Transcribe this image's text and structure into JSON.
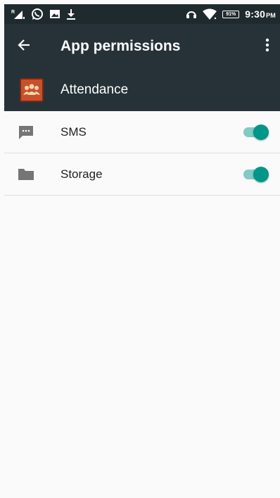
{
  "status_bar": {
    "left_icons": [
      "signal-roaming-icon",
      "whatsapp-icon",
      "image-icon",
      "download-icon"
    ],
    "right_icons": [
      "headset-icon",
      "wifi-icon",
      "battery-icon"
    ],
    "battery_percent": "91%",
    "time": "9:30",
    "ampm": "PM"
  },
  "toolbar": {
    "title": "App permissions",
    "back_icon": "arrow-back-icon",
    "overflow_icon": "more-vert-icon"
  },
  "app": {
    "name": "Attendance",
    "icon": "attendance-app-icon",
    "icon_color": "#c8502c"
  },
  "permissions": [
    {
      "label": "SMS",
      "icon": "message-icon",
      "enabled": true
    },
    {
      "label": "Storage",
      "icon": "folder-icon",
      "enabled": true
    }
  ],
  "colors": {
    "toolbar": "#263238",
    "status_bar": "#1f2a2e",
    "toggle_accent": "#009688",
    "toggle_track": "#80cbc4",
    "list_icon": "#757575"
  }
}
